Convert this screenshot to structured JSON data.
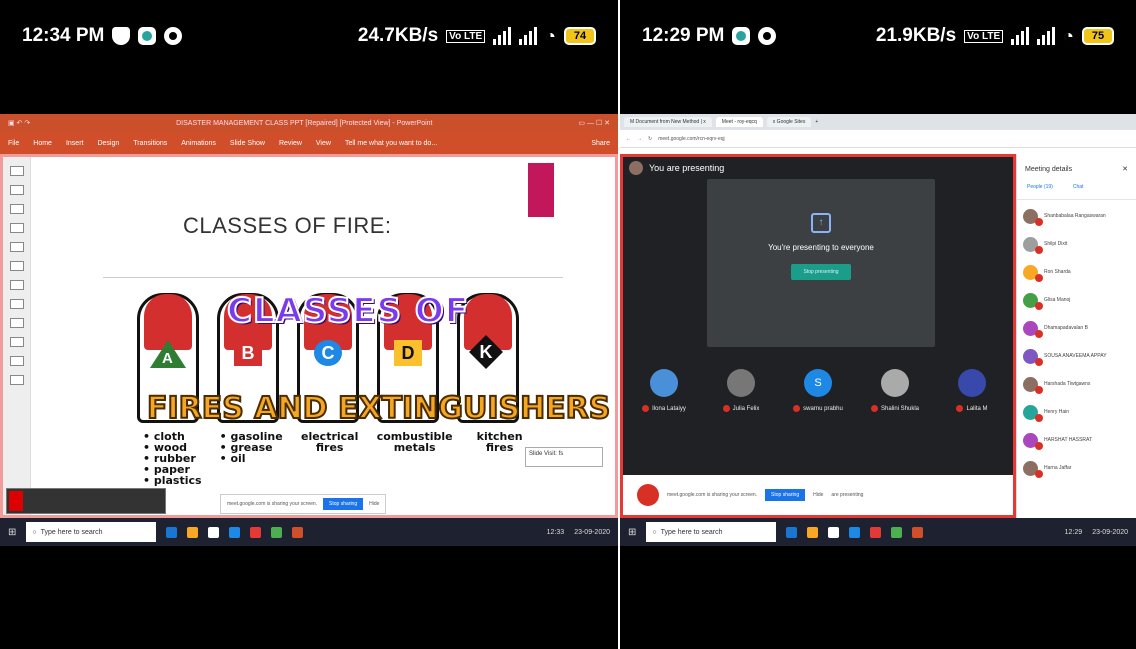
{
  "left": {
    "status": {
      "time": "12:34 PM",
      "speed": "24.7KB/s",
      "lte": "Vo LTE",
      "battery": "74"
    },
    "ppt": {
      "title": "DISASTER MANAGEMENT CLASS PPT [Repaired] [Protected View] - PowerPoint",
      "ribbon": [
        "File",
        "Home",
        "Insert",
        "Design",
        "Transitions",
        "Animations",
        "Slide Show",
        "Review",
        "View",
        "Tell me what you want to do..."
      ],
      "share": "Share",
      "slide_title": "CLASSES OF FIRE:",
      "graphic_line1": "CLASSES OF",
      "graphic_line2": "FIRES AND EXTINGUISHERS",
      "classes": [
        {
          "letter": "A",
          "color": "#2e7d32",
          "items": [
            "• cloth",
            "• wood",
            "• rubber",
            "• paper",
            "• plastics"
          ]
        },
        {
          "letter": "B",
          "color": "#d32f2f",
          "items": [
            "• gasoline",
            "• grease",
            "• oil"
          ]
        },
        {
          "letter": "C",
          "color": "#1e88e5",
          "items": [
            "electrical",
            "fires"
          ]
        },
        {
          "letter": "D",
          "color": "#fbc02d",
          "items": [
            "combustible",
            "metals"
          ]
        },
        {
          "letter": "K",
          "color": "#111111",
          "items": [
            "kitchen",
            "fires"
          ]
        }
      ],
      "notes": "Slide Visit: fs"
    },
    "meet_bar": {
      "text": "meet.google.com is sharing your screen.",
      "stop": "Stop sharing",
      "hide": "Hide"
    },
    "taskbar": {
      "search": "Type here to search",
      "time": "12:33",
      "date": "23-09-2020"
    }
  },
  "right": {
    "status": {
      "time": "12:29 PM",
      "speed": "21.9KB/s",
      "lte": "Vo LTE",
      "battery": "75"
    },
    "chrome": {
      "tabs": [
        "M Document from New Method | x",
        "Meet - roy-eqcq",
        "x Google Sites"
      ],
      "url": "meet.google.com/rcn-eqrv-eqj"
    },
    "meet": {
      "header": "You are presenting",
      "presenting_text": "You're presenting to everyone",
      "stop_button": "Stop presenting",
      "tiles": [
        {
          "name": "Ilona Lataiyy",
          "initial": ""
        },
        {
          "name": "Julia Felix",
          "initial": ""
        },
        {
          "name": "swarnu prabhu",
          "initial": "S"
        },
        {
          "name": "Shalini Shukla",
          "initial": ""
        },
        {
          "name": "Lalita M",
          "initial": ""
        }
      ],
      "bottom_bar": {
        "sharing": "meet.google.com is sharing your screen.",
        "stop": "Stop sharing",
        "hide": "Hide",
        "present_label": "are presenting"
      }
    },
    "panel": {
      "title": "Meeting details",
      "people_tab": "People (19)",
      "chat_tab": "Chat",
      "people": [
        {
          "name": "Shanbabalaa Rangaswaran",
          "color": "#8d6e63"
        },
        {
          "name": "Shilpi Dixit",
          "color": "#9e9e9e"
        },
        {
          "name": "Ron Sharda",
          "color": "#f9a825"
        },
        {
          "name": "Glisa Manoj",
          "color": "#43a047"
        },
        {
          "name": "Dhamapadavalan B",
          "color": "#ab47bc"
        },
        {
          "name": "SOUSA ANAVEEMA APPAY",
          "color": "#7e57c2"
        },
        {
          "name": "Harshada Tiwtgawns",
          "color": "#8d6e63"
        },
        {
          "name": "Henry Hain",
          "color": "#26a69a"
        },
        {
          "name": "HARSHAT HASSRAT",
          "color": "#ab47bc"
        },
        {
          "name": "Harna Jaffar",
          "color": "#8d6e63"
        }
      ]
    },
    "taskbar": {
      "search": "Type here to search",
      "time": "12:29",
      "date": "23-09-2020"
    }
  }
}
